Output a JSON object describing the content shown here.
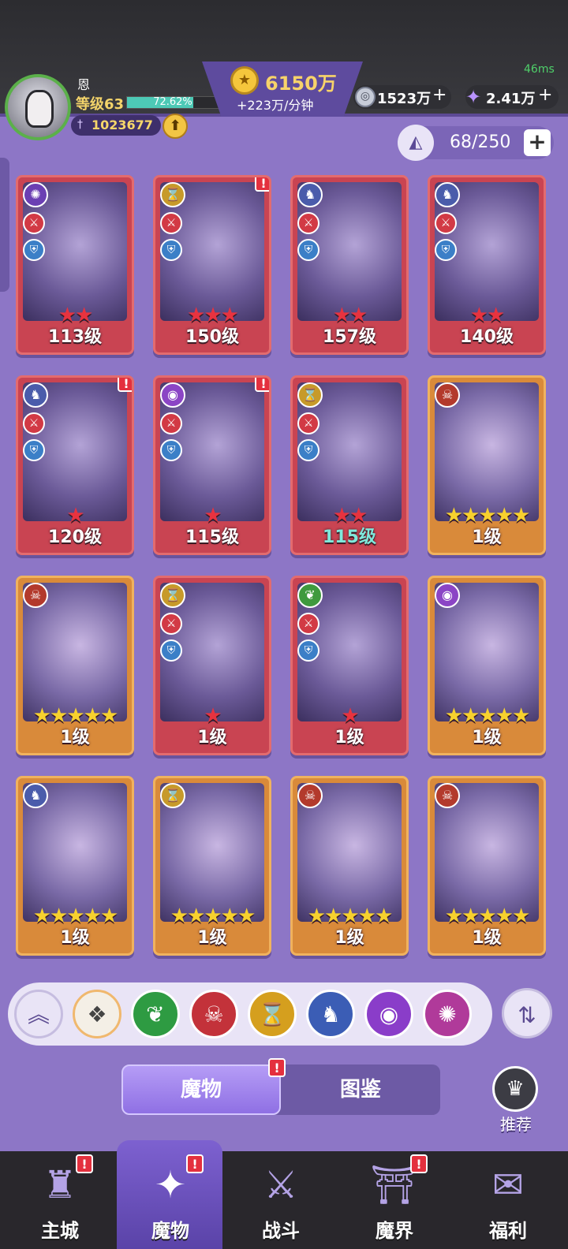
{
  "header": {
    "player_name": "恩",
    "level": "等级63",
    "exp_percent": "72.62%",
    "exp_fraction": 0.7262,
    "power": "1023677",
    "gold_amount": "6150万",
    "gold_rate": "+223万/分钟",
    "resource1_amount": "1523万",
    "resource2_amount": "2.41万",
    "ping": "46ms"
  },
  "capacity": {
    "text": "68/250"
  },
  "cards": [
    {
      "level": "113级",
      "stars": 2,
      "star_color": "red",
      "faction": "purple",
      "icon": "swirl-icon"
    },
    {
      "level": "150级",
      "stars": 3,
      "star_color": "red",
      "faction": "gold",
      "icon": "hourglass-icon",
      "alert": "!"
    },
    {
      "level": "157级",
      "stars": 2,
      "star_color": "red",
      "faction": "white",
      "icon": "wolf-icon"
    },
    {
      "level": "140级",
      "stars": 2,
      "star_color": "red",
      "faction": "white",
      "icon": "wolf-icon"
    },
    {
      "level": "120级",
      "stars": 1,
      "star_color": "red",
      "faction": "white",
      "icon": "wolf-icon",
      "alert": "!"
    },
    {
      "level": "115级",
      "stars": 1,
      "star_color": "red",
      "faction": "eye",
      "icon": "eye-icon",
      "alert": "!"
    },
    {
      "level": "115级",
      "stars": 2,
      "star_color": "red",
      "faction": "gold",
      "icon": "hourglass-icon",
      "teal": true
    },
    {
      "level": "1级",
      "stars": 5,
      "star_color": "gold",
      "faction": "red",
      "icon": "demon-icon"
    },
    {
      "level": "1级",
      "stars": 5,
      "star_color": "gold",
      "faction": "red",
      "icon": "demon-icon"
    },
    {
      "level": "1级",
      "stars": 1,
      "star_color": "red",
      "faction": "gold",
      "icon": "hourglass-icon"
    },
    {
      "level": "1级",
      "stars": 1,
      "star_color": "red",
      "faction": "green",
      "icon": "leaf-icon"
    },
    {
      "level": "1级",
      "stars": 5,
      "star_color": "gold",
      "faction": "eye",
      "icon": "eye-icon"
    },
    {
      "level": "1级",
      "stars": 5,
      "star_color": "gold",
      "faction": "white",
      "icon": "wolf-icon"
    },
    {
      "level": "1级",
      "stars": 5,
      "star_color": "gold",
      "faction": "gold",
      "icon": "hourglass-icon"
    },
    {
      "level": "1级",
      "stars": 5,
      "star_color": "gold",
      "faction": "red",
      "icon": "demon-icon"
    },
    {
      "level": "1级",
      "stars": 5,
      "star_color": "gold",
      "faction": "red",
      "icon": "demon-icon"
    }
  ],
  "filters": [
    {
      "name": "collapse",
      "glyph": "︽"
    },
    {
      "name": "all",
      "glyph": "❖"
    },
    {
      "name": "nature",
      "glyph": "❦"
    },
    {
      "name": "demon",
      "glyph": "☠"
    },
    {
      "name": "time",
      "glyph": "⌛"
    },
    {
      "name": "beast",
      "glyph": "♞"
    },
    {
      "name": "eye",
      "glyph": "◉"
    },
    {
      "name": "chaos",
      "glyph": "✺"
    }
  ],
  "tabs": {
    "monsters": "魔物",
    "codex": "图鉴"
  },
  "recommend_label": "推荐",
  "nav": [
    {
      "label": "主城",
      "icon": "castle-icon",
      "glyph": "♜",
      "alert": "!"
    },
    {
      "label": "魔物",
      "icon": "flame-icon",
      "glyph": "✦",
      "alert": "!",
      "active": true
    },
    {
      "label": "战斗",
      "icon": "shield-sword-icon",
      "glyph": "⚔"
    },
    {
      "label": "魔界",
      "icon": "portal-icon",
      "glyph": "⛩",
      "alert": "!"
    },
    {
      "label": "福利",
      "icon": "chest-icon",
      "glyph": "✉"
    }
  ],
  "colors": {
    "background": "#8d76c6",
    "card_red": "#c94452",
    "card_gold": "#d98a3a",
    "accent_purple": "#8f70e4"
  }
}
